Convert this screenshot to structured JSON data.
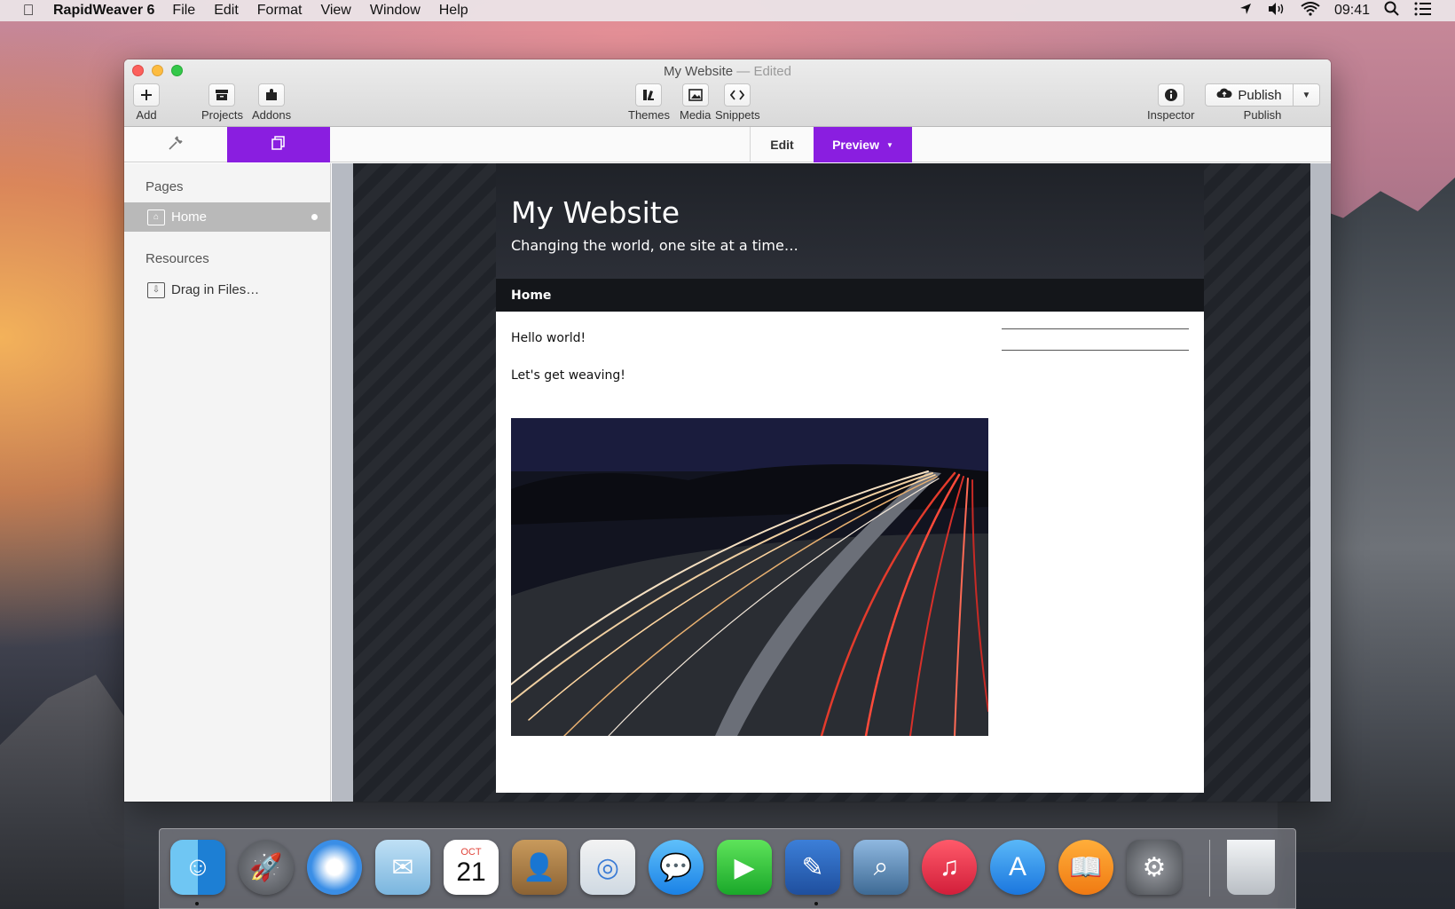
{
  "menubar": {
    "app_name": "RapidWeaver 6",
    "menus": [
      "File",
      "Edit",
      "Format",
      "View",
      "Window",
      "Help"
    ],
    "clock": "09:41"
  },
  "window": {
    "title": "My Website",
    "separator": "—",
    "status": "Edited"
  },
  "toolbar": {
    "add": "Add",
    "projects": "Projects",
    "addons": "Addons",
    "themes": "Themes",
    "media": "Media",
    "snippets": "Snippets",
    "inspector": "Inspector",
    "publish_button": "Publish",
    "publish_label": "Publish"
  },
  "modes": {
    "edit": "Edit",
    "preview": "Preview"
  },
  "sidebar": {
    "pages_header": "Pages",
    "pages": [
      {
        "label": "Home"
      }
    ],
    "resources_header": "Resources",
    "drag_in": "Drag in Files…"
  },
  "site": {
    "title": "My Website",
    "tagline": "Changing the world, one site at a time…",
    "nav": [
      "Home"
    ],
    "paragraphs": [
      "Hello world!",
      "Let's get weaving!"
    ]
  },
  "dock": {
    "calendar_month": "OCT",
    "calendar_day": "21"
  },
  "colors": {
    "accent": "#8a1ee0"
  }
}
